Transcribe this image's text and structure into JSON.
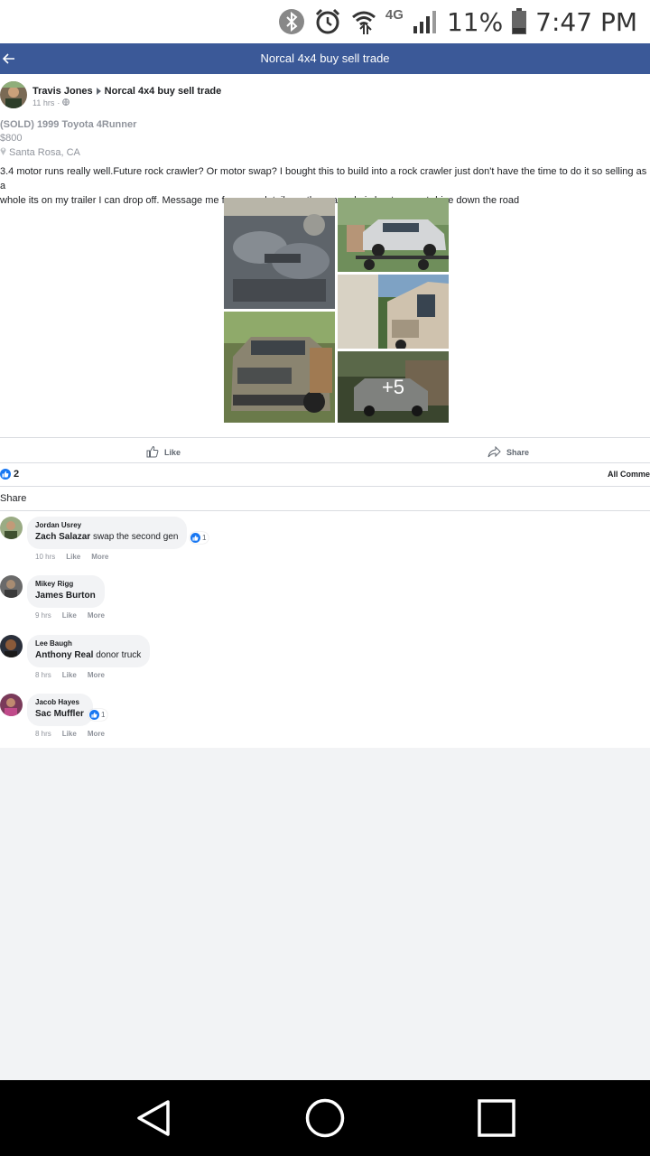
{
  "status_bar": {
    "network": "4G",
    "battery": "11%",
    "time": "7:47 PM",
    "icons": [
      "bluetooth-icon",
      "alarm-icon",
      "wifi-icon",
      "signal-icon",
      "battery-icon"
    ]
  },
  "header": {
    "title": "Norcal 4x4 buy sell trade",
    "back_icon": "back-arrow-icon",
    "bar_color": "#3b5998"
  },
  "post": {
    "author": "Travis Jones",
    "group": "Norcal 4x4 buy sell trade",
    "time": "11 hrs",
    "listing_title": "(SOLD) 1999 Toyota 4Runner",
    "price": "$800",
    "location": "Santa Rosa, CA",
    "body_line1": "3.4 motor runs really well.Future rock crawler? Or motor swap? I bought this to build into a rock crawler just don't have the time to do it so selling as a",
    "body_line2": "whole its on my trailer I can drop off. Message me for more details..... the rear axle is bent can not drive down the road",
    "more_photos": "+5",
    "like_label": "Like",
    "share_label": "Share",
    "reaction_count": "2",
    "all_comments_label": "All Comme",
    "share_row_label": "Share"
  },
  "comments": [
    {
      "name": "Jordan Usrey",
      "tag": "Zach Salazar",
      "text": "swap the second gen",
      "reaction": "1",
      "time": "10 hrs",
      "like": "Like",
      "more": "More"
    },
    {
      "name": "Mikey Rigg",
      "tag": "James Burton",
      "text": "",
      "reaction": "",
      "time": "9 hrs",
      "like": "Like",
      "more": "More"
    },
    {
      "name": "Lee Baugh",
      "tag": "Anthony Real",
      "text": "donor truck",
      "reaction": "",
      "time": "8 hrs",
      "like": "Like",
      "more": "More"
    },
    {
      "name": "Jacob Hayes",
      "tag": "Sac Muffler",
      "text": "",
      "reaction": "1",
      "time": "8 hrs",
      "like": "Like",
      "more": "More"
    }
  ],
  "colors": {
    "accent": "#3b5998",
    "like_blue": "#1877f2",
    "muted_text": "#90949c"
  }
}
